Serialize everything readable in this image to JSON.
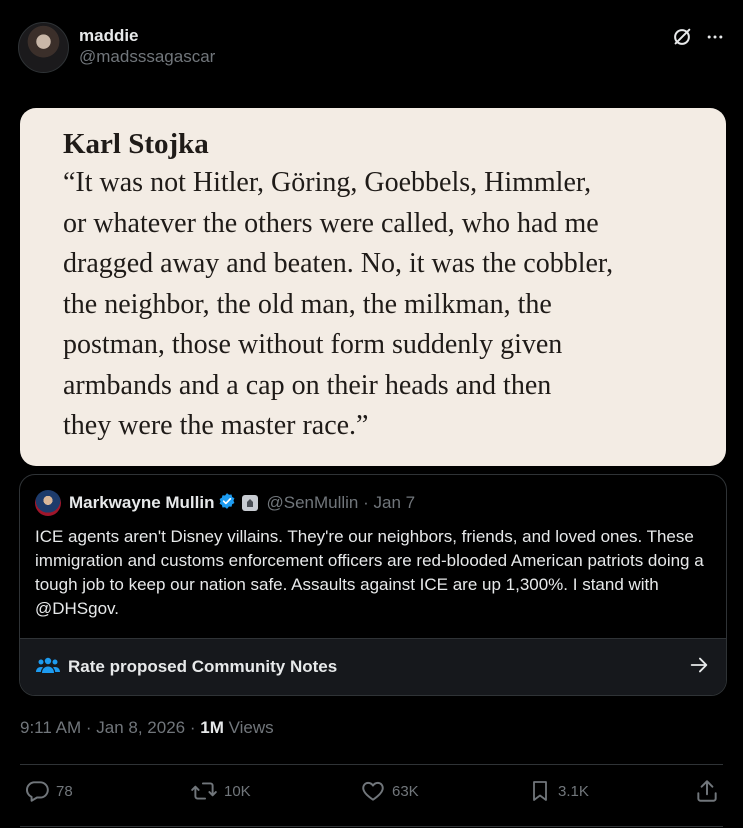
{
  "header": {
    "display_name": "maddie",
    "handle": "@madsssagascar",
    "grok_icon": "grok-icon",
    "more_icon": "more-icon"
  },
  "quote_image": {
    "author": "Karl Stojka",
    "text": "“It was not Hitler, Göring, Goebbels, Himmler,\nor whatever the others were called, who had me\ndragged away and beaten. No, it was the cobbler,\nthe neighbor, the old man, the milkman, the\npostman, those without form suddenly given\narmbands and a cap on their heads and then\nthey were the master race.”"
  },
  "embedded_post": {
    "name": "Markwayne Mullin",
    "handle": "@SenMullin",
    "separator": "·",
    "date": "Jan 7",
    "text": "ICE agents aren't Disney villains. They're our neighbors, friends, and loved ones. These immigration and customs enforcement officers are red-blooded American patriots doing a tough job to keep our nation safe. Assaults against ICE are up 1,300%. I stand with @DHSgov.",
    "community_notes_label": "Rate proposed Community Notes"
  },
  "meta": {
    "time": "9:11 AM",
    "date": "Jan 8, 2026",
    "views_count": "1M",
    "views_label": "Views",
    "sep": "·"
  },
  "actions": {
    "replies": "78",
    "reposts": "10K",
    "likes": "63K",
    "bookmarks": "3.1K"
  },
  "colors": {
    "background": "#000000",
    "text": "#e7e9ea",
    "muted": "#71767b",
    "verified": "#1d9bf0",
    "card_bg": "#f3ece4"
  }
}
